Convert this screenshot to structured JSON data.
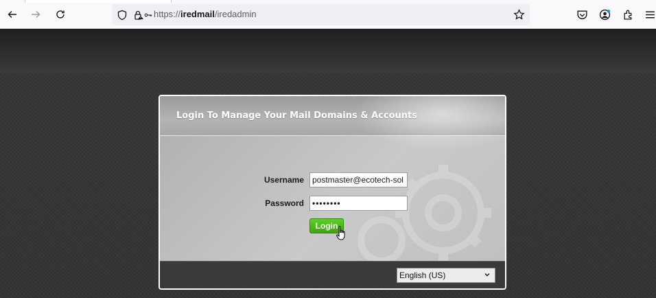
{
  "browser": {
    "url_prefix": "https://",
    "url_host": "iredmail",
    "url_path": "/iredadmin"
  },
  "login": {
    "title": "Login To Manage Your Mail Domains & Accounts",
    "username_label": "Username",
    "username_value": "postmaster@ecotech-sol",
    "password_label": "Password",
    "password_masked": "••••••••",
    "login_button": "Login",
    "language_selected": "English (US)"
  },
  "colors": {
    "login_button": "#4cbb17",
    "page_background": "#333333"
  }
}
